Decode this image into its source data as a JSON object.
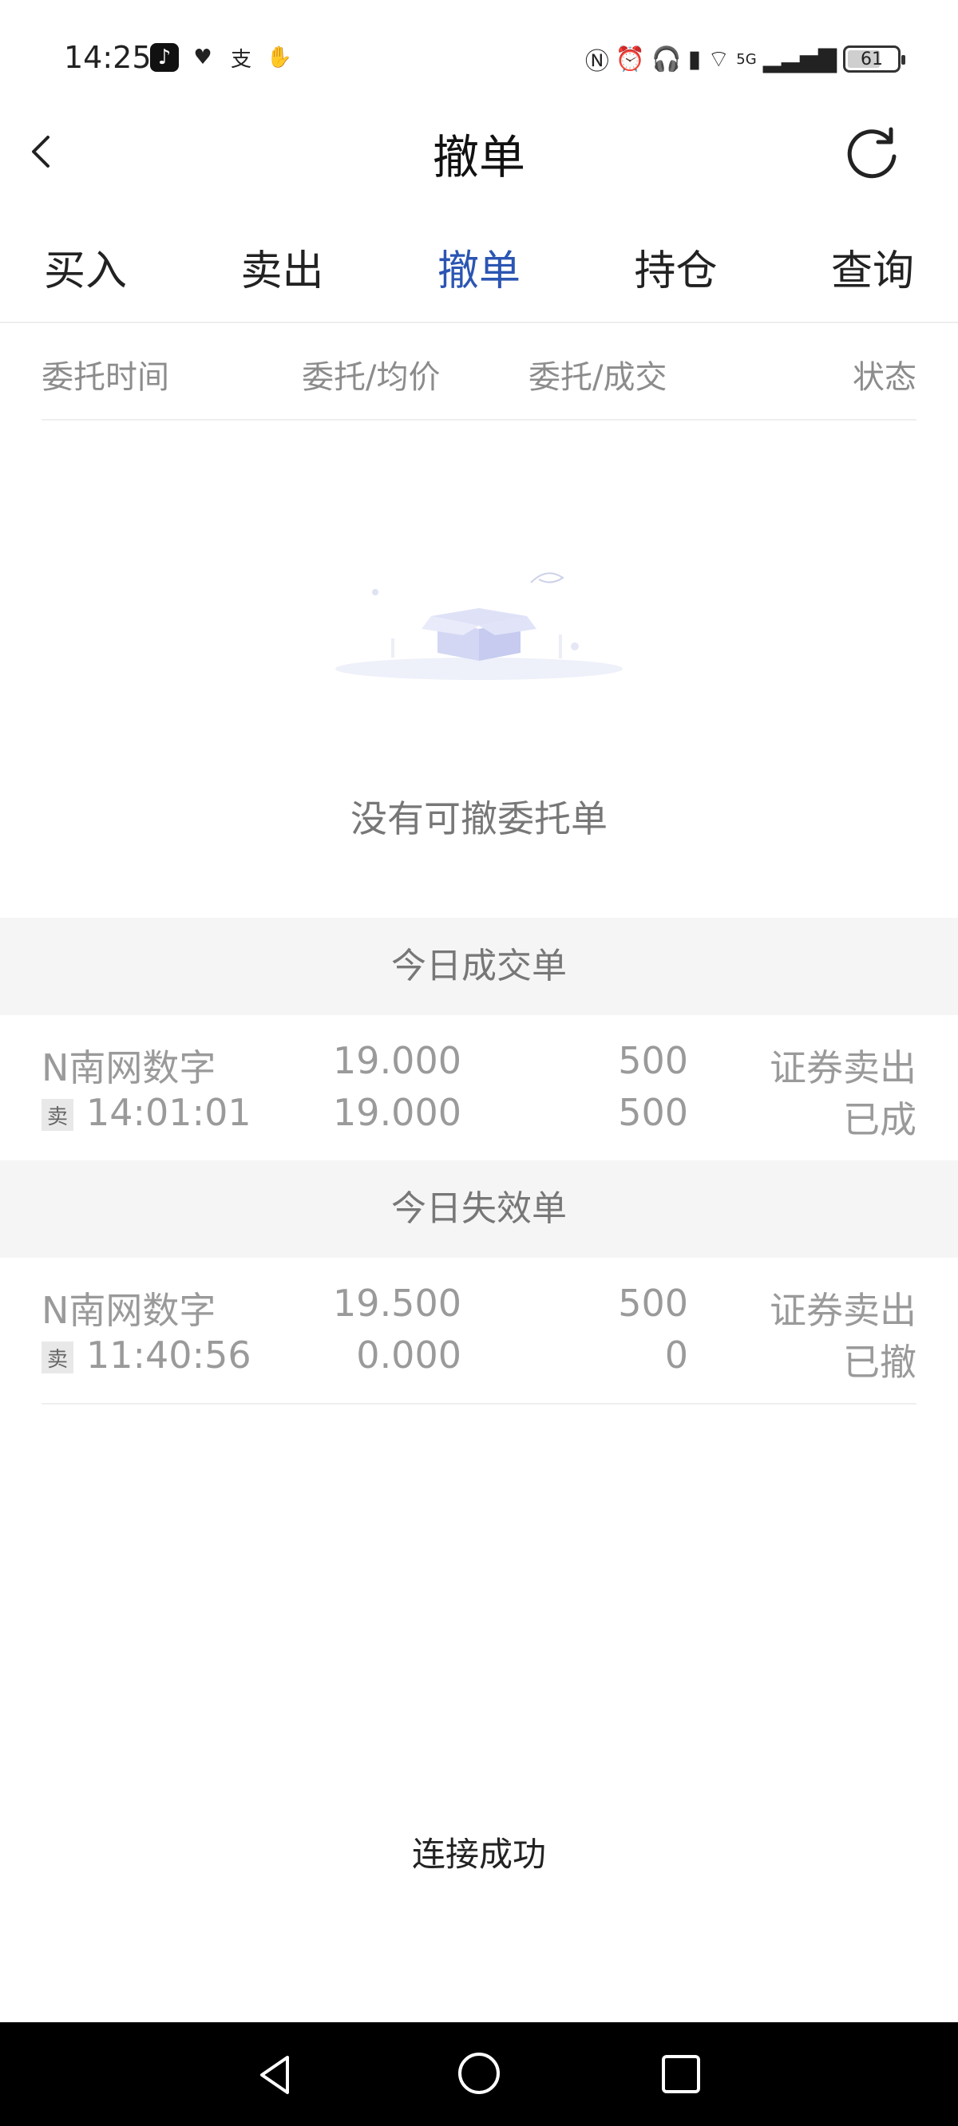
{
  "status_bar": {
    "time": "14:25",
    "left_icons": [
      "tiktok-icon",
      "heart-icon",
      "alipay-icon",
      "hand-icon"
    ],
    "right_icons": [
      "nfc-icon",
      "alarm-icon",
      "headphones-icon",
      "battery-small-icon",
      "wifi-icon",
      "signal-5g-icon"
    ],
    "network_label": "5G",
    "battery": "61"
  },
  "header": {
    "title": "撤单",
    "back_icon": "chevron-left-icon",
    "refresh_icon": "refresh-icon"
  },
  "tabs": [
    {
      "label": "买入",
      "active": false
    },
    {
      "label": "卖出",
      "active": false
    },
    {
      "label": "撤单",
      "active": true
    },
    {
      "label": "持仓",
      "active": false
    },
    {
      "label": "查询",
      "active": false
    }
  ],
  "columns": {
    "time": "委托时间",
    "price": "委托/均价",
    "qty": "委托/成交",
    "status": "状态"
  },
  "empty_state": {
    "illustration": "empty-box-icon",
    "text": "没有可撤委托单"
  },
  "sections": {
    "today_filled": {
      "title": "今日成交单",
      "rows": [
        {
          "name": "N南网数字",
          "side": "卖",
          "time": "14:01:01",
          "price": "19.000",
          "avg_price": "19.000",
          "qty": "500",
          "filled": "500",
          "type": "证券卖出",
          "status": "已成"
        }
      ]
    },
    "today_invalid": {
      "title": "今日失效单",
      "rows": [
        {
          "name": "N南网数字",
          "side": "卖",
          "time": "11:40:56",
          "price": "19.500",
          "avg_price": "0.000",
          "qty": "500",
          "filled": "0",
          "type": "证券卖出",
          "status": "已撤"
        }
      ]
    }
  },
  "connection_status": "连接成功",
  "colors": {
    "accent": "#2b55b3",
    "muted_text": "#9a9a9a",
    "section_bg": "#f5f5f5"
  }
}
